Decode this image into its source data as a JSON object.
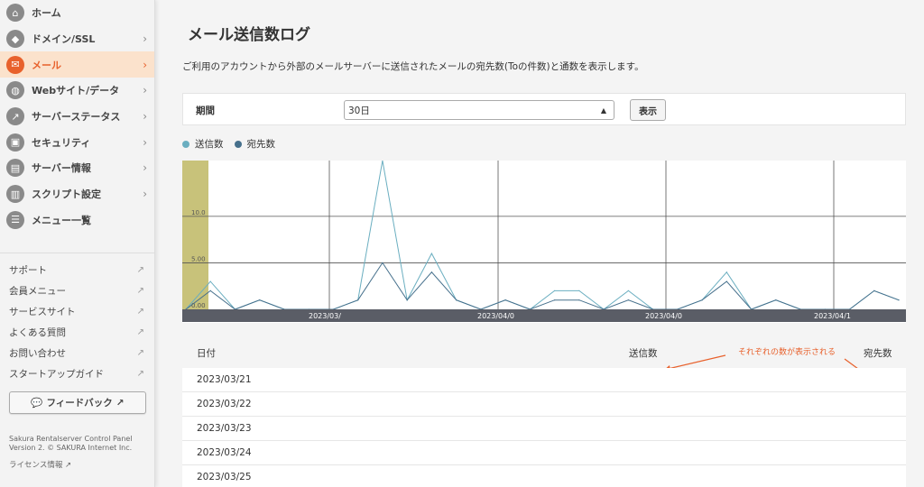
{
  "sidebar": {
    "nav": [
      {
        "label": "ホーム",
        "icon": "home-icon",
        "glyph": "⌂",
        "chevron": false,
        "active": false
      },
      {
        "label": "ドメイン/SSL",
        "icon": "domain-icon",
        "glyph": "◆",
        "chevron": true,
        "active": false
      },
      {
        "label": "メール",
        "icon": "mail-icon",
        "glyph": "✉",
        "chevron": true,
        "active": true
      },
      {
        "label": "Webサイト/データ",
        "icon": "globe-icon",
        "glyph": "◍",
        "chevron": true,
        "active": false
      },
      {
        "label": "サーバーステータス",
        "icon": "status-chart-icon",
        "glyph": "↗",
        "chevron": true,
        "active": false
      },
      {
        "label": "セキュリティ",
        "icon": "lock-icon",
        "glyph": "▣",
        "chevron": true,
        "active": false
      },
      {
        "label": "サーバー情報",
        "icon": "server-icon",
        "glyph": "▤",
        "chevron": true,
        "active": false
      },
      {
        "label": "スクリプト設定",
        "icon": "script-file-icon",
        "glyph": "▥",
        "chevron": true,
        "active": false
      },
      {
        "label": "メニュー一覧",
        "icon": "list-icon",
        "glyph": "☰",
        "chevron": false,
        "active": false
      }
    ],
    "links": [
      "サポート",
      "会員メニュー",
      "サービスサイト",
      "よくある質問",
      "お問い合わせ",
      "スタートアップガイド"
    ],
    "feedback_label": "フィードバック",
    "footer_line1": "Sakura Rentalserver Control Panel",
    "footer_line2": "Version 2. © SAKURA Internet Inc.",
    "license_label": "ライセンス情報"
  },
  "main": {
    "title": "メール送信数ログ",
    "description": "ご利用のアカウントから外部のメールサーバーに送信されたメールの宛先数(Toの件数)と通数を表示します。",
    "period_label": "期間",
    "period_value": "30日",
    "show_button": "表示",
    "legend_sent": "送信数",
    "legend_dest": "宛先数",
    "col_date": "日付",
    "col_sent": "送信数",
    "col_dest": "宛先数",
    "annotation": "それぞれの数が表示される",
    "rows": [
      "2023/03/21",
      "2023/03/22",
      "2023/03/23",
      "2023/03/24",
      "2023/03/25"
    ]
  },
  "colors": {
    "accent": "#e8612c",
    "sent_series": "#6aaec0",
    "dest_series": "#46708c",
    "highlight_band": "#c8c27a",
    "axis_bar": "#5a5d66"
  },
  "chart_data": {
    "type": "line",
    "yticks": [
      "0.00",
      "5.00",
      "10.0"
    ],
    "ylim": [
      0,
      16
    ],
    "xtick_labels": [
      "2023/03/",
      "2023/04/0",
      "2023/04/0",
      "2023/04/1"
    ],
    "series": [
      {
        "name": "送信数",
        "values": [
          0,
          3,
          0,
          1,
          0,
          0,
          0,
          1,
          16,
          1,
          6,
          1,
          0,
          1,
          0,
          2,
          2,
          0,
          2,
          0,
          0,
          1,
          4,
          0,
          1,
          0,
          0,
          0,
          2,
          1
        ]
      },
      {
        "name": "宛先数",
        "values": [
          0,
          2,
          0,
          1,
          0,
          0,
          0,
          1,
          5,
          1,
          4,
          1,
          0,
          1,
          0,
          1,
          1,
          0,
          1,
          0,
          0,
          1,
          3,
          0,
          1,
          0,
          0,
          0,
          2,
          1
        ]
      }
    ]
  }
}
